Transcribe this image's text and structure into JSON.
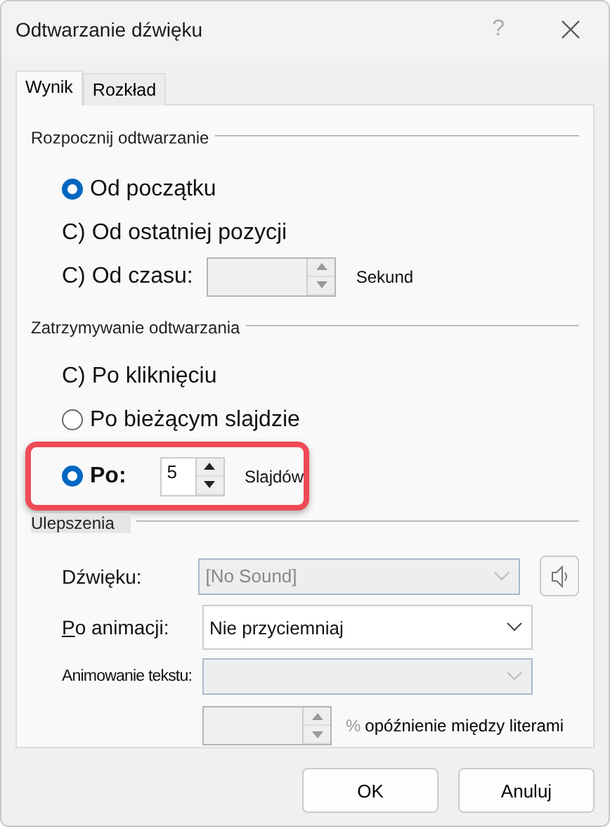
{
  "window": {
    "title": "Odtwarzanie dźwięku",
    "help": "?"
  },
  "tabs": [
    {
      "label": "Wynik",
      "selected": true
    },
    {
      "label": "Rozkład",
      "selected": false
    }
  ],
  "start_group": {
    "title": "Rozpocznij odtwarzanie",
    "options": [
      {
        "kind": "radio",
        "label": "Od początku",
        "selected": true
      },
      {
        "kind": "plain",
        "label": "C) Od ostatniej pozycji"
      },
      {
        "kind": "spin",
        "label": "C) Od czasu:",
        "disabled": true,
        "unit": "Sekund"
      }
    ]
  },
  "stop_group": {
    "title": "Zatrzymywanie odtwarzania",
    "options": [
      {
        "kind": "plain",
        "label": "C) Po kliknięciu"
      },
      {
        "kind": "radio",
        "label": "Po bieżącym slajdzie",
        "selected": false
      },
      {
        "kind": "radio-spin",
        "label": "Po:",
        "selected": true,
        "value": "5",
        "unit": "Slajdów",
        "highlighted": true
      }
    ]
  },
  "enhancements": {
    "title": "Ulepszenia",
    "rows": [
      {
        "kind": "combo",
        "label": "Dźwięku:",
        "value": "[No Sound]",
        "disabled": true,
        "speaker": true,
        "underline_first": false,
        "small": false
      },
      {
        "kind": "combo",
        "label": "Po animacji:",
        "value": "Nie przyciemniaj",
        "disabled": false,
        "speaker": false,
        "underline_first": true,
        "small": false
      },
      {
        "kind": "combo",
        "label": "Animowanie tekstu:",
        "disabled": true,
        "speaker": false,
        "underline_first": false,
        "small": true
      }
    ],
    "delay": {
      "percent": "%",
      "label": "opóźnienie między literami",
      "disabled": true
    }
  },
  "buttons": [
    {
      "label": "OK"
    },
    {
      "label": "Anuluj"
    }
  ]
}
